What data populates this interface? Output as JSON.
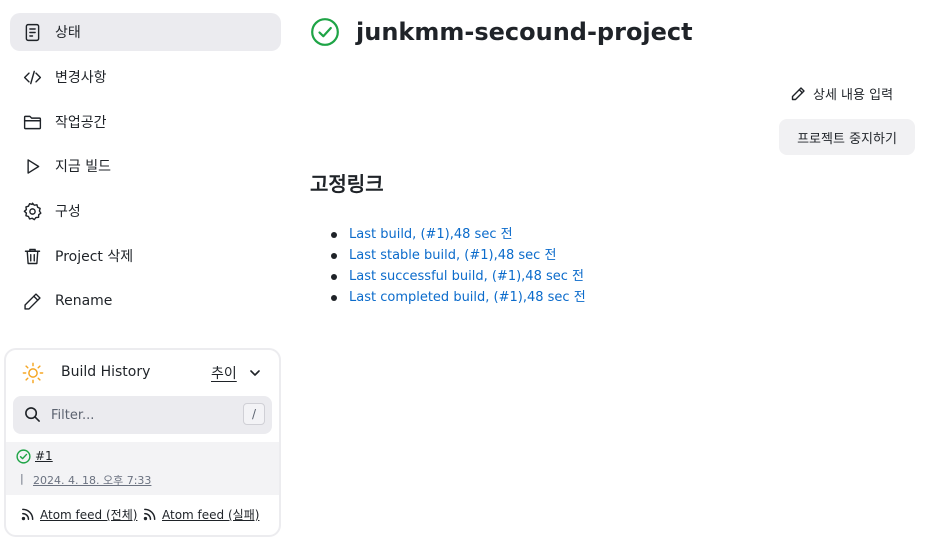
{
  "sidebar": {
    "items": [
      {
        "label": "상태",
        "icon": "document-icon"
      },
      {
        "label": "변경사항",
        "icon": "code-icon"
      },
      {
        "label": "작업공간",
        "icon": "folder-icon"
      },
      {
        "label": "지금 빌드",
        "icon": "play-icon"
      },
      {
        "label": "구성",
        "icon": "gear-icon"
      },
      {
        "label": "Project 삭제",
        "icon": "trash-icon"
      },
      {
        "label": "Rename",
        "icon": "pencil-icon"
      }
    ]
  },
  "build_history": {
    "title": "Build History",
    "trend_label": "추이",
    "filter_placeholder": "Filter...",
    "filter_shortcut": "/",
    "builds": [
      {
        "number": "#1",
        "separator": "|",
        "date": "2024. 4. 18. 오후 7:33",
        "status": "success"
      }
    ],
    "feeds": {
      "all": "Atom feed (전체)",
      "failed": "Atom feed (실패)"
    }
  },
  "main": {
    "project_name": "junkmm-secound-project",
    "edit_description": "상세 내용 입력",
    "disable_project": "프로젝트 중지하기",
    "permalinks_title": "고정링크",
    "permalinks": [
      "Last build, (#1),48 sec 전",
      "Last stable build, (#1),48 sec 전",
      "Last successful build, (#1),48 sec 전",
      "Last completed build, (#1),48 sec 전"
    ]
  },
  "colors": {
    "success": "#1ea446",
    "link": "#0b6bcb",
    "active_bg": "#ebebef",
    "sun": "#f5a623"
  }
}
